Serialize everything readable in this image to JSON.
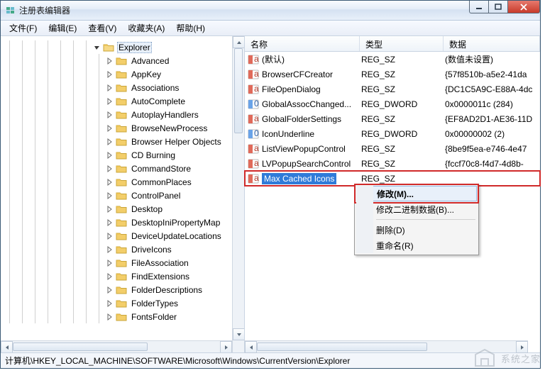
{
  "window": {
    "title": "注册表编辑器"
  },
  "menu": {
    "file": "文件(F)",
    "edit": "编辑(E)",
    "view": "查看(V)",
    "fav": "收藏夹(A)",
    "help": "帮助(H)"
  },
  "tree": {
    "root": "Explorer",
    "children": [
      "Advanced",
      "AppKey",
      "Associations",
      "AutoComplete",
      "AutoplayHandlers",
      "BrowseNewProcess",
      "Browser Helper Objects",
      "CD Burning",
      "CommandStore",
      "CommonPlaces",
      "ControlPanel",
      "Desktop",
      "DesktopIniPropertyMap",
      "DeviceUpdateLocations",
      "DriveIcons",
      "FileAssociation",
      "FindExtensions",
      "FolderDescriptions",
      "FolderTypes",
      "FontsFolder"
    ]
  },
  "columns": {
    "name": "名称",
    "type": "类型",
    "data": "数据"
  },
  "rows": [
    {
      "icon": "sz",
      "name": "(默认)",
      "type": "REG_SZ",
      "data": "(数值未设置)"
    },
    {
      "icon": "sz",
      "name": "BrowserCFCreator",
      "type": "REG_SZ",
      "data": "{57f8510b-a5e2-41da"
    },
    {
      "icon": "sz",
      "name": "FileOpenDialog",
      "type": "REG_SZ",
      "data": "{DC1C5A9C-E88A-4dc"
    },
    {
      "icon": "dw",
      "name": "GlobalAssocChanged...",
      "type": "REG_DWORD",
      "data": "0x0000011c (284)"
    },
    {
      "icon": "sz",
      "name": "GlobalFolderSettings",
      "type": "REG_SZ",
      "data": "{EF8AD2D1-AE36-11D"
    },
    {
      "icon": "dw",
      "name": "IconUnderline",
      "type": "REG_DWORD",
      "data": "0x00000002 (2)"
    },
    {
      "icon": "sz",
      "name": "ListViewPopupControl",
      "type": "REG_SZ",
      "data": "{8be9f5ea-e746-4e47"
    },
    {
      "icon": "sz",
      "name": "LVPopupSearchControl",
      "type": "REG_SZ",
      "data": "{fccf70c8-f4d7-4d8b-"
    },
    {
      "icon": "sz",
      "name": "Max Cached Icons",
      "type": "REG_SZ",
      "data": "",
      "selected": true
    }
  ],
  "context_menu": {
    "modify": "修改(M)...",
    "modify_bin": "修改二进制数据(B)...",
    "delete": "删除(D)",
    "rename": "重命名(R)"
  },
  "status": "计算机\\HKEY_LOCAL_MACHINE\\SOFTWARE\\Microsoft\\Windows\\CurrentVersion\\Explorer",
  "watermark": "系统之家"
}
